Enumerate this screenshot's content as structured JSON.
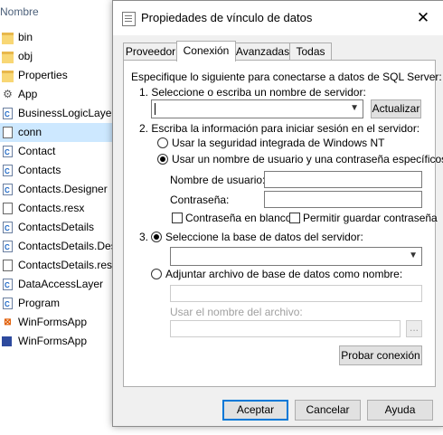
{
  "explorer": {
    "header": "Nombre",
    "items": [
      {
        "label": "bin",
        "icon": "folder-icon"
      },
      {
        "label": "obj",
        "icon": "folder-icon"
      },
      {
        "label": "Properties",
        "icon": "folder-icon"
      },
      {
        "label": "App",
        "icon": "gear-icon"
      },
      {
        "label": "BusinessLogicLayer",
        "icon": "csharp-file-icon"
      },
      {
        "label": "conn",
        "icon": "data-link-file-icon"
      },
      {
        "label": "Contact",
        "icon": "csharp-file-icon"
      },
      {
        "label": "Contacts",
        "icon": "csharp-file-icon"
      },
      {
        "label": "Contacts.Designer",
        "icon": "csharp-file-icon"
      },
      {
        "label": "Contacts.resx",
        "icon": "file-icon"
      },
      {
        "label": "ContactsDetails",
        "icon": "csharp-file-icon"
      },
      {
        "label": "ContactsDetails.Designer",
        "icon": "csharp-file-icon"
      },
      {
        "label": "ContactsDetails.resx",
        "icon": "file-icon"
      },
      {
        "label": "DataAccessLayer",
        "icon": "csharp-file-icon"
      },
      {
        "label": "Program",
        "icon": "csharp-file-icon"
      },
      {
        "label": "WinFormsApp",
        "icon": "xml-file-icon"
      },
      {
        "label": "WinFormsApp",
        "icon": "app-icon"
      }
    ],
    "selected": "conn"
  },
  "dialog": {
    "title": "Propiedades de vínculo de datos",
    "close": "✕",
    "tabs": [
      "Proveedor",
      "Conexión",
      "Avanzadas",
      "Todas"
    ],
    "active_tab": "Conexión",
    "intro": "Especifique lo siguiente para conectarse a datos de SQL Server:",
    "step1": "1. Seleccione o escriba un nombre de servidor:",
    "server_value": "",
    "refresh_button": "Actualizar",
    "step2": "2. Escriba la información para iniciar sesión en el servidor:",
    "radio_windows": "Usar la seguridad integrada de Windows NT",
    "radio_user": "Usar un nombre de usuario y una contraseña específicos:",
    "username_label": "Nombre de usuario:",
    "username_value": "",
    "password_label": "Contraseña:",
    "password_value": "",
    "check_blank": "Contraseña en blanco",
    "check_save": "Permitir guardar contraseña",
    "step3": "3.",
    "radio_select_db": "Seleccione la base de datos del servidor:",
    "database_value": "",
    "radio_attach": "Adjuntar archivo de base de datos como nombre:",
    "attach_value": "",
    "logical_name_label": "Usar el nombre del archivo:",
    "browse_button": "...",
    "test_button": "Probar conexión",
    "ok_button": "Aceptar",
    "cancel_button": "Cancelar",
    "help_button": "Ayuda"
  },
  "colors": {
    "accent": "#0078d7",
    "selection": "#cde8ff",
    "disabled_text": "#a0a0a0"
  }
}
